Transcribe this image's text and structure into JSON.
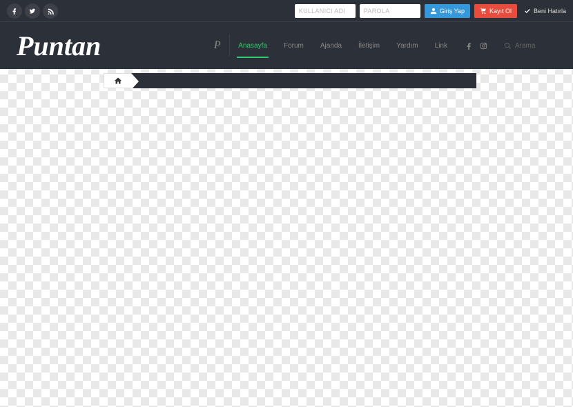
{
  "topbar": {
    "username_placeholder": "KULLANICI ADI",
    "password_placeholder": "PAROLA",
    "login_label": "Giriş Yap",
    "register_label": "Kayıt Ol",
    "remember_label": "Beni Hatırla"
  },
  "logo": "Puntan",
  "nav": {
    "items": [
      {
        "label": "Anasayfa",
        "active": true
      },
      {
        "label": "Forum",
        "active": false
      },
      {
        "label": "Ajanda",
        "active": false
      },
      {
        "label": "İletişim",
        "active": false
      },
      {
        "label": "Yardım",
        "active": false
      },
      {
        "label": "Link",
        "active": false
      }
    ],
    "search_placeholder": "Arama"
  }
}
